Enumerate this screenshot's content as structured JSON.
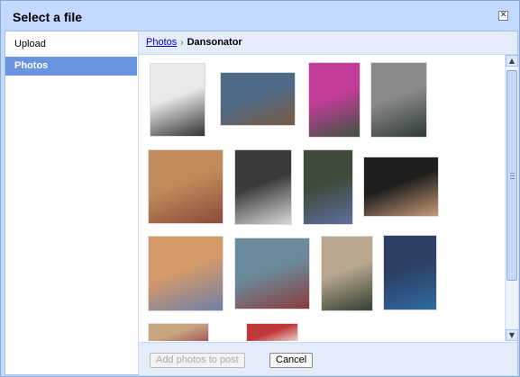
{
  "dialog": {
    "title": "Select a file",
    "close_glyph": "✕"
  },
  "sidebar": {
    "items": [
      {
        "label": "Upload"
      },
      {
        "label": "Photos"
      }
    ],
    "active_index": 1
  },
  "breadcrumb": {
    "root": "Photos",
    "separator": "›",
    "current": "Dansonator"
  },
  "scrollbar": {
    "up_glyph": "▲",
    "down_glyph": "▼"
  },
  "footer": {
    "add_label": "Add photos to post",
    "cancel_label": "Cancel"
  },
  "photos": [
    {
      "name": "photo-1",
      "colors": [
        "#e9e9e9",
        "#333333"
      ]
    },
    {
      "name": "photo-2",
      "colors": [
        "#4f6a86",
        "#7a5a44"
      ]
    },
    {
      "name": "photo-3",
      "colors": [
        "#c23c9a",
        "#3f5440"
      ]
    },
    {
      "name": "photo-4",
      "colors": [
        "#8a8a8a",
        "#2f3a34"
      ]
    },
    {
      "name": "photo-5",
      "colors": [
        "#c08a5a",
        "#8a4b3a"
      ]
    },
    {
      "name": "photo-6",
      "colors": [
        "#3a3a3a",
        "#d8d8d8"
      ]
    },
    {
      "name": "photo-7",
      "colors": [
        "#3e4a3a",
        "#5f6fa0"
      ]
    },
    {
      "name": "photo-8",
      "colors": [
        "#1e1e1e",
        "#c99a7a"
      ]
    },
    {
      "name": "photo-9",
      "colors": [
        "#d49a6a",
        "#6f7fa8"
      ]
    },
    {
      "name": "photo-10",
      "colors": [
        "#6b8a9c",
        "#8a3d3d"
      ]
    },
    {
      "name": "photo-11",
      "colors": [
        "#b9a88f",
        "#2f3f30"
      ]
    },
    {
      "name": "photo-12",
      "colors": [
        "#2e4066",
        "#2f6ba0"
      ]
    },
    {
      "name": "photo-13",
      "colors": [
        "#c7a57f",
        "#a0505a"
      ]
    },
    {
      "name": "photo-14",
      "colors": [
        "#c0383a",
        "#f0e8e0"
      ]
    }
  ]
}
